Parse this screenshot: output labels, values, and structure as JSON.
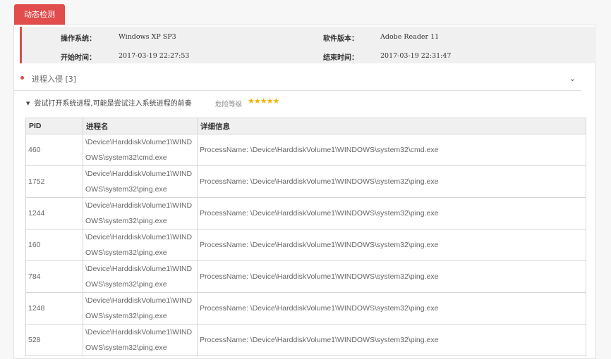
{
  "tab": {
    "label": "动态检测"
  },
  "info": {
    "os_label": "操作系统：",
    "os_value": "Windows XP SP3",
    "sw_label": "软件版本：",
    "sw_value": "Adobe Reader 11",
    "start_label": "开始时间：",
    "start_value": "2017-03-19 22:27:53",
    "end_label": "结束时间：",
    "end_value": "2017-03-19 22:31:47"
  },
  "section": {
    "title": "进程入侵 [3]",
    "chevron_icon": "chevron-down-icon"
  },
  "subsection": {
    "title": "尝试打开系统进程,可能是尝试注入系统进程的前奏",
    "risk_label": "危险等级",
    "risk_stars": "★★★★★",
    "risk_level": 5,
    "star_color": "#f2b200"
  },
  "colors": {
    "accent": "#e14c4c"
  },
  "table": {
    "headers": [
      "PID",
      "进程名",
      "详细信息"
    ],
    "rows": [
      {
        "pid": "460",
        "process": "\\Device\\HarddiskVolume1\\WINDOWS\\system32\\cmd.exe",
        "detail": "ProcessName: \\Device\\HarddiskVolume1\\WINDOWS\\system32\\cmd.exe"
      },
      {
        "pid": "1752",
        "process": "\\Device\\HarddiskVolume1\\WINDOWS\\system32\\ping.exe",
        "detail": "ProcessName: \\Device\\HarddiskVolume1\\WINDOWS\\system32\\ping.exe"
      },
      {
        "pid": "1244",
        "process": "\\Device\\HarddiskVolume1\\WINDOWS\\system32\\ping.exe",
        "detail": "ProcessName: \\Device\\HarddiskVolume1\\WINDOWS\\system32\\ping.exe"
      },
      {
        "pid": "160",
        "process": "\\Device\\HarddiskVolume1\\WINDOWS\\system32\\ping.exe",
        "detail": "ProcessName: \\Device\\HarddiskVolume1\\WINDOWS\\system32\\ping.exe"
      },
      {
        "pid": "784",
        "process": "\\Device\\HarddiskVolume1\\WINDOWS\\system32\\ping.exe",
        "detail": "ProcessName: \\Device\\HarddiskVolume1\\WINDOWS\\system32\\ping.exe"
      },
      {
        "pid": "1248",
        "process": "\\Device\\HarddiskVolume1\\WINDOWS\\system32\\ping.exe",
        "detail": "ProcessName: \\Device\\HarddiskVolume1\\WINDOWS\\system32\\ping.exe"
      },
      {
        "pid": "528",
        "process": "\\Device\\HarddiskVolume1\\WINDOWS\\system32\\ping.exe",
        "detail": "ProcessName: \\Device\\HarddiskVolume1\\WINDOWS\\system32\\ping.exe"
      }
    ]
  }
}
